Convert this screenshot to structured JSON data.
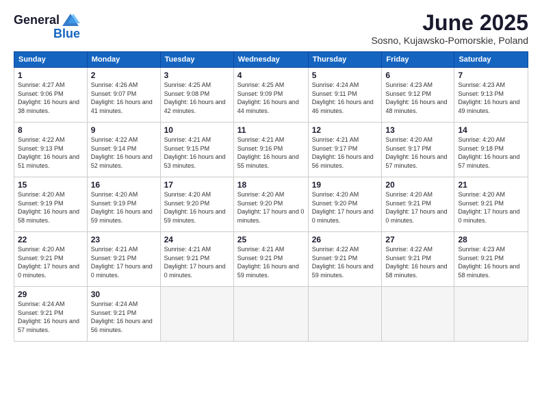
{
  "logo": {
    "general": "General",
    "blue": "Blue"
  },
  "title": "June 2025",
  "location": "Sosno, Kujawsko-Pomorskie, Poland",
  "weekdays": [
    "Sunday",
    "Monday",
    "Tuesday",
    "Wednesday",
    "Thursday",
    "Friday",
    "Saturday"
  ],
  "weeks": [
    [
      {
        "day": "1",
        "sunrise": "4:27 AM",
        "sunset": "9:06 PM",
        "daylight": "16 hours and 38 minutes."
      },
      {
        "day": "2",
        "sunrise": "4:26 AM",
        "sunset": "9:07 PM",
        "daylight": "16 hours and 41 minutes."
      },
      {
        "day": "3",
        "sunrise": "4:25 AM",
        "sunset": "9:08 PM",
        "daylight": "16 hours and 42 minutes."
      },
      {
        "day": "4",
        "sunrise": "4:25 AM",
        "sunset": "9:09 PM",
        "daylight": "16 hours and 44 minutes."
      },
      {
        "day": "5",
        "sunrise": "4:24 AM",
        "sunset": "9:11 PM",
        "daylight": "16 hours and 46 minutes."
      },
      {
        "day": "6",
        "sunrise": "4:23 AM",
        "sunset": "9:12 PM",
        "daylight": "16 hours and 48 minutes."
      },
      {
        "day": "7",
        "sunrise": "4:23 AM",
        "sunset": "9:13 PM",
        "daylight": "16 hours and 49 minutes."
      }
    ],
    [
      {
        "day": "8",
        "sunrise": "4:22 AM",
        "sunset": "9:13 PM",
        "daylight": "16 hours and 51 minutes."
      },
      {
        "day": "9",
        "sunrise": "4:22 AM",
        "sunset": "9:14 PM",
        "daylight": "16 hours and 52 minutes."
      },
      {
        "day": "10",
        "sunrise": "4:21 AM",
        "sunset": "9:15 PM",
        "daylight": "16 hours and 53 minutes."
      },
      {
        "day": "11",
        "sunrise": "4:21 AM",
        "sunset": "9:16 PM",
        "daylight": "16 hours and 55 minutes."
      },
      {
        "day": "12",
        "sunrise": "4:21 AM",
        "sunset": "9:17 PM",
        "daylight": "16 hours and 56 minutes."
      },
      {
        "day": "13",
        "sunrise": "4:20 AM",
        "sunset": "9:17 PM",
        "daylight": "16 hours and 57 minutes."
      },
      {
        "day": "14",
        "sunrise": "4:20 AM",
        "sunset": "9:18 PM",
        "daylight": "16 hours and 57 minutes."
      }
    ],
    [
      {
        "day": "15",
        "sunrise": "4:20 AM",
        "sunset": "9:19 PM",
        "daylight": "16 hours and 58 minutes."
      },
      {
        "day": "16",
        "sunrise": "4:20 AM",
        "sunset": "9:19 PM",
        "daylight": "16 hours and 59 minutes."
      },
      {
        "day": "17",
        "sunrise": "4:20 AM",
        "sunset": "9:20 PM",
        "daylight": "16 hours and 59 minutes."
      },
      {
        "day": "18",
        "sunrise": "4:20 AM",
        "sunset": "9:20 PM",
        "daylight": "17 hours and 0 minutes."
      },
      {
        "day": "19",
        "sunrise": "4:20 AM",
        "sunset": "9:20 PM",
        "daylight": "17 hours and 0 minutes."
      },
      {
        "day": "20",
        "sunrise": "4:20 AM",
        "sunset": "9:21 PM",
        "daylight": "17 hours and 0 minutes."
      },
      {
        "day": "21",
        "sunrise": "4:20 AM",
        "sunset": "9:21 PM",
        "daylight": "17 hours and 0 minutes."
      }
    ],
    [
      {
        "day": "22",
        "sunrise": "4:20 AM",
        "sunset": "9:21 PM",
        "daylight": "17 hours and 0 minutes."
      },
      {
        "day": "23",
        "sunrise": "4:21 AM",
        "sunset": "9:21 PM",
        "daylight": "17 hours and 0 minutes."
      },
      {
        "day": "24",
        "sunrise": "4:21 AM",
        "sunset": "9:21 PM",
        "daylight": "17 hours and 0 minutes."
      },
      {
        "day": "25",
        "sunrise": "4:21 AM",
        "sunset": "9:21 PM",
        "daylight": "16 hours and 59 minutes."
      },
      {
        "day": "26",
        "sunrise": "4:22 AM",
        "sunset": "9:21 PM",
        "daylight": "16 hours and 59 minutes."
      },
      {
        "day": "27",
        "sunrise": "4:22 AM",
        "sunset": "9:21 PM",
        "daylight": "16 hours and 58 minutes."
      },
      {
        "day": "28",
        "sunrise": "4:23 AM",
        "sunset": "9:21 PM",
        "daylight": "16 hours and 58 minutes."
      }
    ],
    [
      {
        "day": "29",
        "sunrise": "4:24 AM",
        "sunset": "9:21 PM",
        "daylight": "16 hours and 57 minutes."
      },
      {
        "day": "30",
        "sunrise": "4:24 AM",
        "sunset": "9:21 PM",
        "daylight": "16 hours and 56 minutes."
      },
      null,
      null,
      null,
      null,
      null
    ]
  ]
}
